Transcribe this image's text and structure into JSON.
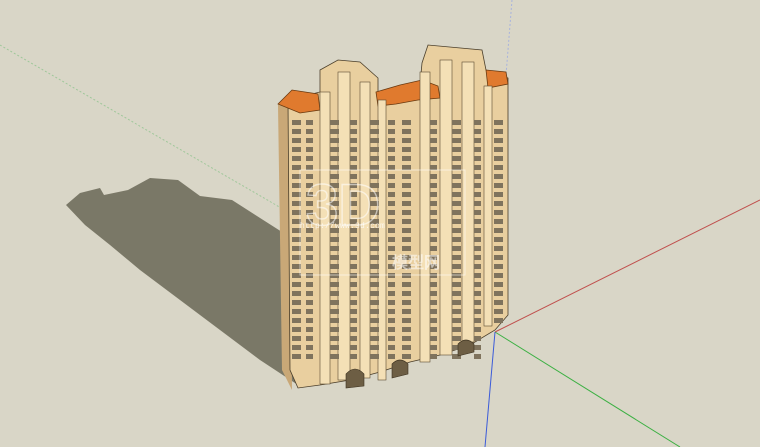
{
  "app": {
    "name": "3D model viewport"
  },
  "scene": {
    "subject": "high-rise residential tower",
    "background_color": "#d9d6c7",
    "axes": [
      {
        "name": "red-axis",
        "color": "#c0504d"
      },
      {
        "name": "green-axis",
        "color": "#3cb043"
      },
      {
        "name": "blue-axis",
        "color": "#3b5bd9"
      }
    ],
    "materials": {
      "facade": "#e9cf9f",
      "facade_shade": "#c9a877",
      "roof": "#e07a2e",
      "window": "#7f735d",
      "shadow": "#7a7867"
    }
  },
  "watermark": {
    "logo_text": "3D",
    "url_text": "http://www.3d.com",
    "line2": "模型网"
  }
}
